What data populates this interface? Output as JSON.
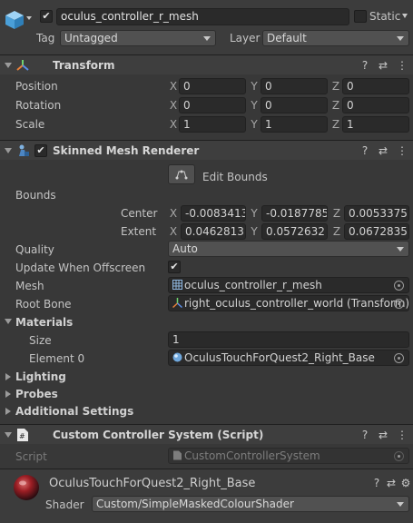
{
  "header": {
    "object_name": "oculus_controller_r_mesh",
    "static_label": "Static",
    "tag_label": "Tag",
    "tag_value": "Untagged",
    "layer_label": "Layer",
    "layer_value": "Default"
  },
  "transform": {
    "title": "Transform",
    "position": {
      "label": "Position",
      "x": "0",
      "y": "0",
      "z": "0"
    },
    "rotation": {
      "label": "Rotation",
      "x": "0",
      "y": "0",
      "z": "0"
    },
    "scale": {
      "label": "Scale",
      "x": "1",
      "y": "1",
      "z": "1"
    },
    "axis_x": "X",
    "axis_y": "Y",
    "axis_z": "Z"
  },
  "skinned": {
    "title": "Skinned Mesh Renderer",
    "edit_bounds": "Edit Bounds",
    "bounds_label": "Bounds",
    "center_label": "Center",
    "center": {
      "x": "-0.0083413",
      "y": "-0.0187785",
      "z": "0.0053375"
    },
    "extent_label": "Extent",
    "extent": {
      "x": "0.0462813",
      "y": "0.0572632",
      "z": "0.0672835"
    },
    "quality_label": "Quality",
    "quality_value": "Auto",
    "update_label": "Update When Offscreen",
    "mesh_label": "Mesh",
    "mesh_value": "oculus_controller_r_mesh",
    "root_bone_label": "Root Bone",
    "root_bone_value": "right_oculus_controller_world (Transform)",
    "materials_label": "Materials",
    "size_label": "Size",
    "size_value": "1",
    "element0_label": "Element 0",
    "element0_value": "OculusTouchForQuest2_Right_Base",
    "lighting_label": "Lighting",
    "probes_label": "Probes",
    "additional_label": "Additional Settings"
  },
  "script_comp": {
    "title": "Custom Controller System (Script)",
    "script_label": "Script",
    "script_value": "CustomControllerSystem"
  },
  "material": {
    "name": "OculusTouchForQuest2_Right_Base",
    "shader_label": "Shader",
    "shader_value": "Custom/SimpleMaskedColourShader"
  },
  "icons": {
    "check": "✔",
    "help": "?",
    "settings": "⇄",
    "more": "⋮",
    "gear": "⚙"
  }
}
